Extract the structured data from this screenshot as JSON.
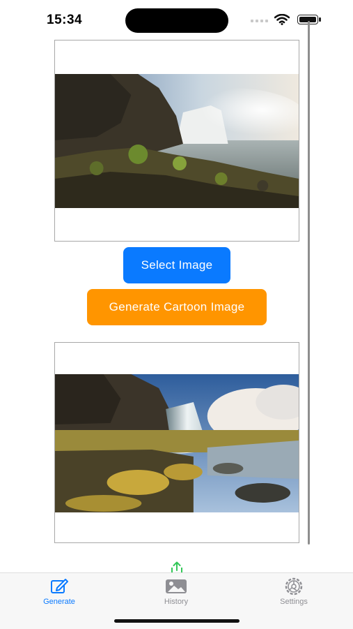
{
  "status_bar": {
    "time": "15:34",
    "icons": [
      "signal-icon",
      "wifi-icon",
      "battery-icon"
    ]
  },
  "images": {
    "source": {
      "description_icon": "waterfall-photo"
    },
    "result": {
      "description_icon": "waterfall-cartoon"
    }
  },
  "buttons": {
    "select_label": "Select Image",
    "generate_label": "Generate Cartoon Image",
    "select_color": "#0a7aff",
    "generate_color": "#ff9500"
  },
  "tab_bar": {
    "active_color": "#0a7aff",
    "inactive_color": "#8e8e93",
    "tabs": [
      {
        "label": "Generate",
        "icon": "edit-icon",
        "active": true
      },
      {
        "label": "History",
        "icon": "photo-icon",
        "active": false
      },
      {
        "label": "Settings",
        "icon": "gear-icon",
        "active": false
      }
    ]
  }
}
